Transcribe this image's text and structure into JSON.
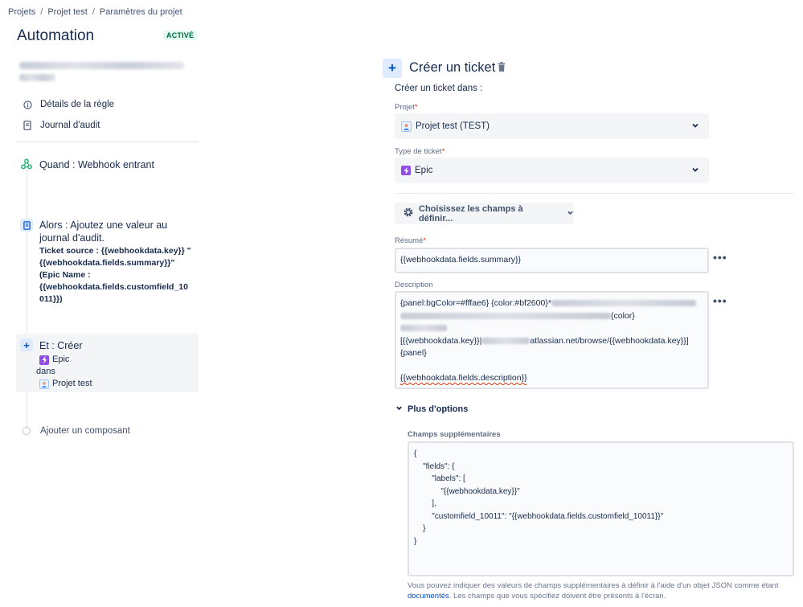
{
  "breadcrumb": {
    "items": [
      "Projets",
      "Projet test",
      "Paramètres du projet"
    ],
    "sep": "/"
  },
  "header": {
    "title": "Automation",
    "status": "ACTIVÉ"
  },
  "sidebar": {
    "rule_details": "Détails de la règle",
    "audit_log": "Journal d'audit",
    "add_component": "Ajouter un composant"
  },
  "flow": {
    "trigger": {
      "title": "Quand : Webhook entrant"
    },
    "action1": {
      "title": "Alors : Ajoutez une valeur au journal d'audit.",
      "detail_lines": [
        "Ticket source : {{webhookdata.key}} \"",
        "{{webhookdata.fields.summary}}\"",
        "(Epic Name :",
        "{{webhookdata.fields.customfield_10",
        "011}})"
      ]
    },
    "action2": {
      "title": "Et : Créer",
      "issue_type": "Epic",
      "in_word": "dans",
      "project": "Projet test"
    }
  },
  "panel": {
    "title": "Créer un ticket",
    "create_in": "Créer un ticket dans :",
    "project_label": "Projet",
    "project_value": "Projet test (TEST)",
    "issue_type_label": "Type de ticket",
    "issue_type_value": "Epic",
    "fields_button": "Choisissez les champs à définir...",
    "summary_label": "Résumé",
    "summary_value": "{{webhookdata.fields.summary}}",
    "description_label": "Description",
    "description": {
      "l1_a": "{panel:bgColor=#fffae6} {color:#bf2600}*",
      "l2_b": "{color}",
      "l4_a": "[{{webhookdata.key}}|",
      "l4_b": "atlassian.net/browse/{{webhookdata.key}}]",
      "l5": "{panel}",
      "l7": "{{webhookdata.fields.description}}"
    },
    "more_options": "Plus d'options",
    "extra_fields_label": "Champs supplémentaires",
    "json_lines": [
      "{",
      "    \"fields\": {",
      "        \"labels\": [",
      "            \"{{webhookdata.key}}\"",
      "        ],",
      "        \"customfield_10011\": \"{{webhookdata.fields.customfield_10011}}\"",
      "    }",
      "}"
    ],
    "help_before": "Vous pouvez indiquer des valeurs de champs supplémentaires à définir à l'aide d'un objet JSON comme étant ",
    "help_link": "documentés",
    "help_after": ". Les champs que vous spécifiez doivent être présents à l'écran."
  },
  "required_mark": "*",
  "more_glyph": "•••",
  "colors": {
    "accent": "#0052cc",
    "epic": "#904ee2",
    "status_green": "#006644",
    "trigger_green": "#36b37e"
  }
}
